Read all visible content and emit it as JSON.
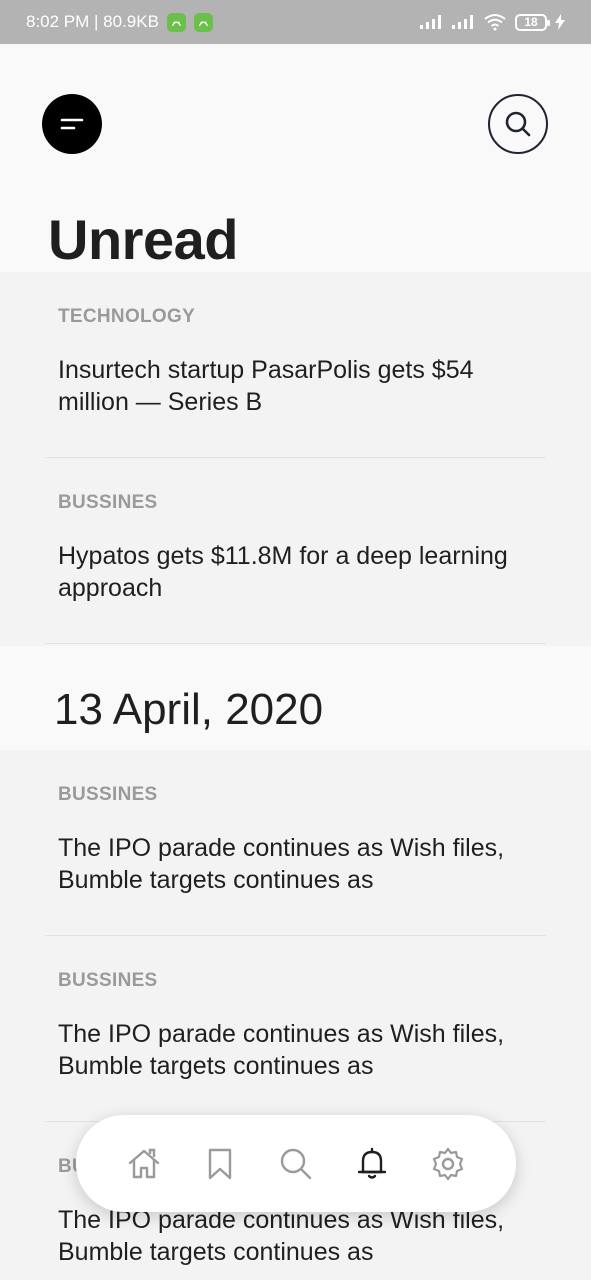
{
  "status_bar": {
    "time_info": "8:02 PM | 80.9KB",
    "battery": "18"
  },
  "header": {
    "menu_icon": "menu-icon",
    "search_icon": "search-icon",
    "title": "Unread"
  },
  "unread_articles": [
    {
      "category": "TECHNOLOGY",
      "title": "Insurtech startup PasarPolis gets $54 million — Series B"
    },
    {
      "category": "BUSSINES",
      "title": "Hypatos gets $11.8M for a deep learning approach"
    }
  ],
  "date_heading": "13 April, 2020",
  "dated_articles": [
    {
      "category": "BUSSINES",
      "title": "The IPO parade continues as Wish files, Bumble targets continues as"
    },
    {
      "category": "BUSSINES",
      "title": "The IPO parade continues as Wish files, Bumble targets continues as"
    },
    {
      "category": "BUSSINES",
      "title": "The IPO parade continues as Wish files, Bumble targets continues as"
    }
  ],
  "bottom_nav": {
    "items": [
      "home-icon",
      "bookmark-icon",
      "search-icon",
      "bell-icon",
      "gear-icon"
    ],
    "active": "bell-icon"
  },
  "colors": {
    "status_bar": "#b3b3b3",
    "background": "#f9f9f9",
    "card_background": "#f3f3f3",
    "category_text": "#9a9a9a",
    "active_icon": "#1f1f1f",
    "inactive_icon": "#9a9a9a"
  }
}
